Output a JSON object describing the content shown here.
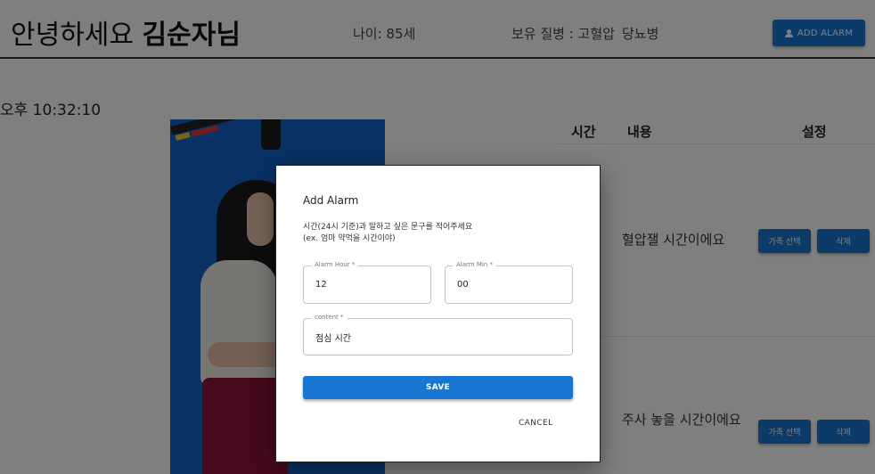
{
  "header": {
    "greeting": "안녕하세요",
    "user_name": "김순자님",
    "age": "나이: 85세",
    "disease_label": "보유 질병 : 고혈압",
    "disease_extra": "당뇨병",
    "add_alarm_label": "ADD ALARM"
  },
  "clock": "오후 10:32:10",
  "table": {
    "headers": {
      "time": "시간",
      "content": "내용",
      "settings": "설정"
    },
    "rows": [
      {
        "content": "혈압잴 시간이에요",
        "family_btn": "가족 선택",
        "delete_btn": "삭제"
      },
      {
        "content": "주사 놓을 시간이에요",
        "family_btn": "가족 선택",
        "delete_btn": "삭제"
      }
    ]
  },
  "dialog": {
    "title": "Add Alarm",
    "desc_line1": "시간(24시 기준)과 말하고 싶은 문구를 적어주세요",
    "desc_line2": "(ex. 엄마 약먹을 시간이야)",
    "hour_label": "Alarm Hour *",
    "hour_value": "12",
    "min_label": "Alarm Min *",
    "min_value": "00",
    "content_label": "content *",
    "content_value": "점심 시간",
    "save_label": "SAVE",
    "cancel_label": "CANCEL"
  },
  "colors": {
    "primary": "#1976d2",
    "photo_background": "#1262c9"
  }
}
